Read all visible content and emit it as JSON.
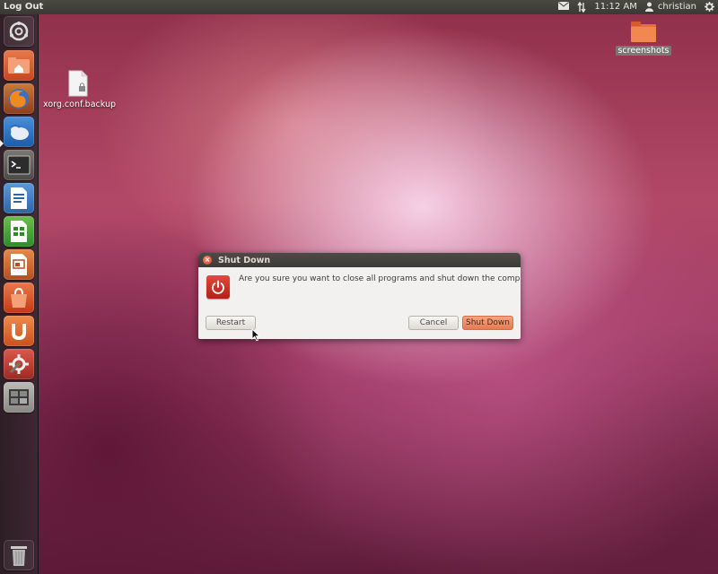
{
  "top_panel": {
    "title": "Log Out",
    "time": "11:12 AM",
    "username": "christian",
    "icons": [
      "mail-icon",
      "network-icon",
      "user-icon",
      "gear-icon"
    ]
  },
  "launcher": {
    "items": [
      {
        "name": "dash-icon"
      },
      {
        "name": "home-folder-icon"
      },
      {
        "name": "firefox-icon"
      },
      {
        "name": "thunderbird-icon"
      },
      {
        "name": "terminal-icon"
      },
      {
        "name": "writer-icon"
      },
      {
        "name": "calc-icon"
      },
      {
        "name": "impress-icon"
      },
      {
        "name": "software-center-icon"
      },
      {
        "name": "ubuntu-one-icon"
      },
      {
        "name": "system-settings-icon"
      },
      {
        "name": "workspace-switcher-icon"
      },
      {
        "name": "trash-icon"
      }
    ]
  },
  "desktop": {
    "files": [
      {
        "label": "xorg.conf.backup",
        "icon": "document-icon"
      },
      {
        "label": "screenshots",
        "icon": "folder-icon"
      }
    ]
  },
  "dialog": {
    "title": "Shut Down",
    "message": "Are you sure you want to close all programs and shut down the computer?",
    "buttons": {
      "restart": "Restart",
      "cancel": "Cancel",
      "shutdown": "Shut Down"
    }
  },
  "colors": {
    "accent": "#e67b52",
    "power_red": "#c62a1f",
    "panel": "#3c3b37",
    "close": "#e05a35"
  }
}
